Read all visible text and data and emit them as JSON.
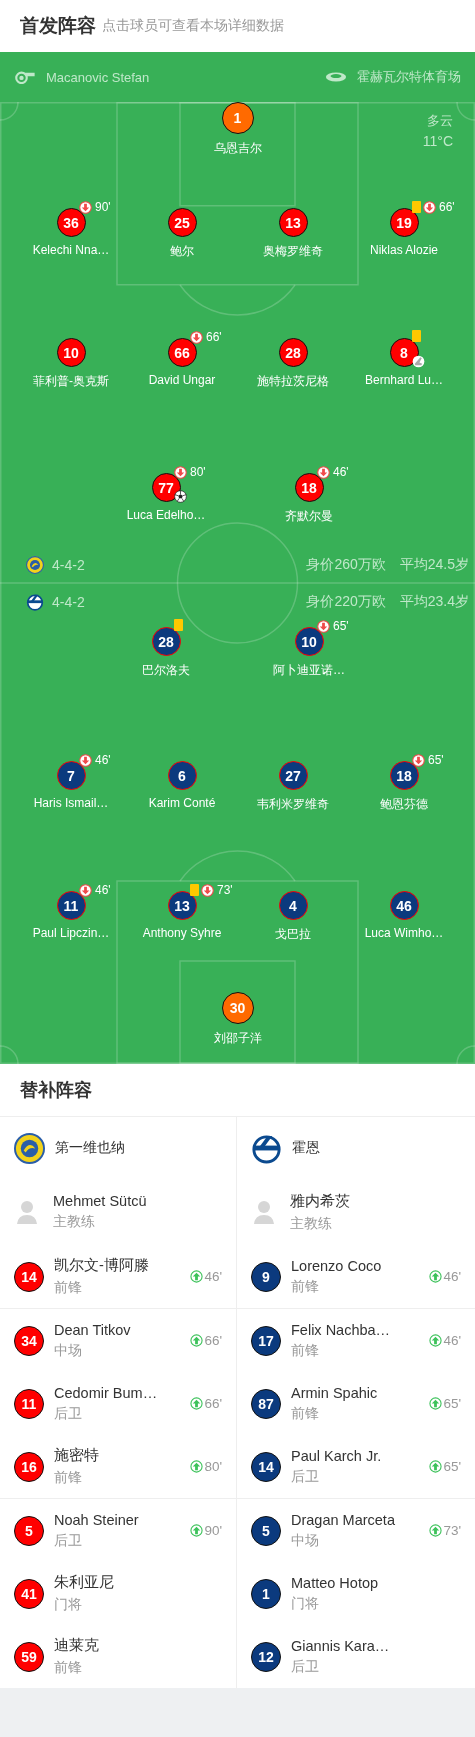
{
  "header": {
    "title": "首发阵容",
    "hint": "点击球员可查看本场详细数据"
  },
  "match": {
    "referee": "Macanovic Stefan",
    "venue": "霍赫瓦尔特体育场",
    "weather": "多云",
    "temperature": "11°C"
  },
  "teams": [
    {
      "kind": "home",
      "formation": "4-4-2",
      "market_value": "身价260万欧",
      "average_age": "平均24.5岁",
      "lines": [
        {
          "kind": "goalkeeper",
          "players": [
            {
              "number": "1",
              "name": "乌恩吉尔"
            }
          ]
        },
        {
          "kind": "defence",
          "players": [
            {
              "number": "36",
              "name": "Kelechi Nna…",
              "events": [
                {
                  "kind": "sub_off",
                  "minute": "90'"
                }
              ]
            },
            {
              "number": "25",
              "name": "鲍尔"
            },
            {
              "number": "13",
              "name": "奥梅罗维奇"
            },
            {
              "number": "19",
              "name": "Niklas Alozie",
              "events": [
                {
                  "kind": "booking"
                },
                {
                  "kind": "sub_off",
                  "minute": "66'"
                }
              ]
            }
          ]
        },
        {
          "kind": "midfield",
          "players": [
            {
              "number": "10",
              "name": "菲利普-奥克斯"
            },
            {
              "number": "66",
              "name": "David Ungar",
              "events": [
                {
                  "kind": "sub_off",
                  "minute": "66'"
                }
              ]
            },
            {
              "number": "28",
              "name": "施特拉茨尼格"
            },
            {
              "number": "8",
              "name": "Bernhard Lu…",
              "events": [
                {
                  "kind": "booking"
                },
                {
                  "kind": "assist"
                }
              ]
            }
          ]
        },
        {
          "kind": "attack",
          "players": [
            {
              "number": "77",
              "name": "Luca Edelho…",
              "events": [
                {
                  "kind": "sub_off",
                  "minute": "80'"
                },
                {
                  "kind": "goal"
                }
              ]
            },
            {
              "number": "18",
              "name": "齐默尔曼",
              "events": [
                {
                  "kind": "sub_off",
                  "minute": "46'"
                }
              ]
            }
          ]
        }
      ]
    },
    {
      "kind": "away",
      "formation": "4-4-2",
      "market_value": "身价220万欧",
      "average_age": "平均23.4岁",
      "lines": [
        {
          "kind": "attack",
          "players": [
            {
              "number": "28",
              "name": "巴尔洛夫",
              "events": [
                {
                  "kind": "booking"
                }
              ]
            },
            {
              "number": "10",
              "name": "阿卜迪亚诺…",
              "events": [
                {
                  "kind": "sub_off",
                  "minute": "65'"
                }
              ]
            }
          ]
        },
        {
          "kind": "midfield",
          "players": [
            {
              "number": "7",
              "name": "Haris Ismail…",
              "events": [
                {
                  "kind": "sub_off",
                  "minute": "46'"
                }
              ]
            },
            {
              "number": "6",
              "name": "Karim Conté"
            },
            {
              "number": "27",
              "name": "韦利米罗维奇"
            },
            {
              "number": "18",
              "name": "鲍恩芬德",
              "events": [
                {
                  "kind": "sub_off",
                  "minute": "65'"
                }
              ]
            }
          ]
        },
        {
          "kind": "defence",
          "players": [
            {
              "number": "11",
              "name": "Paul Lipczin…",
              "events": [
                {
                  "kind": "sub_off",
                  "minute": "46'"
                }
              ]
            },
            {
              "number": "13",
              "name": "Anthony Syhre",
              "events": [
                {
                  "kind": "booking"
                },
                {
                  "kind": "sub_off",
                  "minute": "73'"
                }
              ]
            },
            {
              "number": "4",
              "name": "戈巴拉"
            },
            {
              "number": "46",
              "name": "Luca Wimho…"
            }
          ]
        },
        {
          "kind": "goalkeeper",
          "players": [
            {
              "number": "30",
              "name": "刘邵子洋"
            }
          ]
        }
      ]
    }
  ],
  "substitutes": {
    "title": "替补阵容",
    "teams": [
      {
        "kind": "home",
        "name": "第一维也纳",
        "coach": {
          "name": "Mehmet Sütcü",
          "role": "主教练"
        }
      },
      {
        "kind": "away",
        "name": "霍恩",
        "coach": {
          "name": "雅内希茨",
          "role": "主教练"
        }
      }
    ],
    "groups": [
      [
        {
          "home": {
            "number": "14",
            "name": "凯尔文-博阿滕",
            "position": "前锋",
            "minute": "46'"
          },
          "away": {
            "number": "9",
            "name": "Lorenzo Coco",
            "position": "前锋",
            "minute": "46'"
          }
        }
      ],
      [
        {
          "home": {
            "number": "34",
            "name": "Dean Titkov",
            "position": "中场",
            "minute": "66'"
          },
          "away": {
            "number": "17",
            "name": "Felix Nachba…",
            "position": "前锋",
            "minute": "46'"
          }
        },
        {
          "home": {
            "number": "11",
            "name": "Cedomir Bum…",
            "position": "后卫",
            "minute": "66'"
          },
          "away": {
            "number": "87",
            "name": "Armin Spahic",
            "position": "前锋",
            "minute": "65'"
          }
        },
        {
          "home": {
            "number": "16",
            "name": "施密特",
            "position": "前锋",
            "minute": "80'"
          },
          "away": {
            "number": "14",
            "name": "Paul Karch Jr.",
            "position": "后卫",
            "minute": "65'"
          }
        }
      ],
      [
        {
          "home": {
            "number": "5",
            "name": "Noah Steiner",
            "position": "后卫",
            "minute": "90'"
          },
          "away": {
            "number": "5",
            "name": "Dragan Marceta",
            "position": "中场",
            "minute": "73'"
          }
        },
        {
          "home": {
            "number": "41",
            "name": "朱利亚尼",
            "position": "门将"
          },
          "away": {
            "number": "1",
            "name": "Matteo Hotop",
            "position": "门将"
          }
        },
        {
          "home": {
            "number": "59",
            "name": "迪莱克",
            "position": "前锋"
          },
          "away": {
            "number": "12",
            "name": "Giannis Kara…",
            "position": "后卫"
          }
        }
      ]
    ]
  }
}
